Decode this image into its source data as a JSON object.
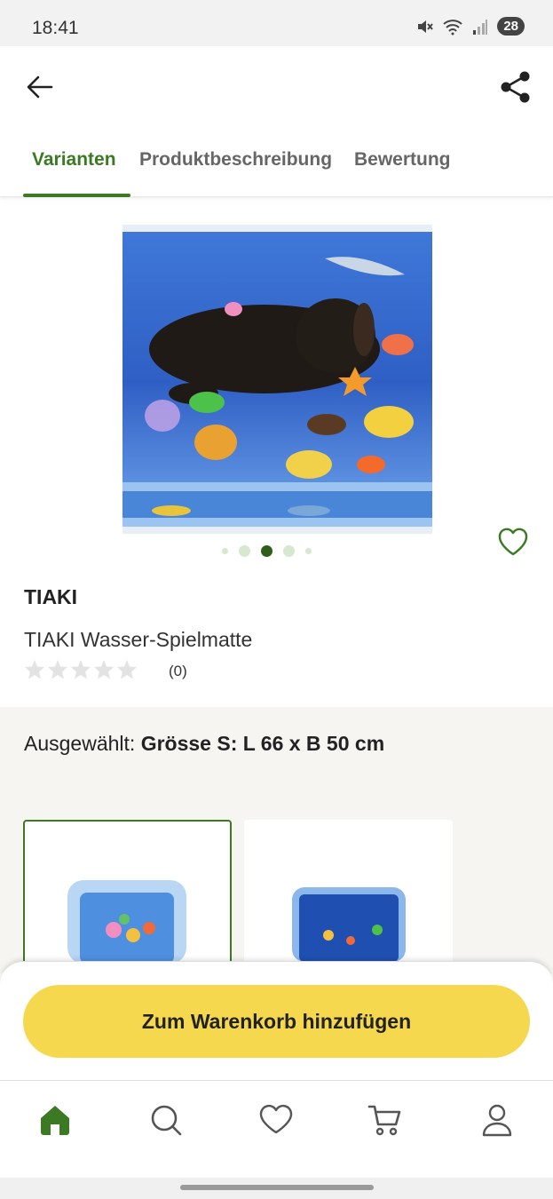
{
  "status": {
    "time": "18:41",
    "battery": "28"
  },
  "tabs": [
    {
      "label": "Varianten",
      "active": true
    },
    {
      "label": "Produktbeschreibung",
      "active": false
    },
    {
      "label": "Bewertung",
      "active": false
    }
  ],
  "product": {
    "brand": "TIAKI",
    "name": "TIAKI Wasser-Spielmatte",
    "rating_count": "(0)",
    "rating": 0,
    "rating_max": 5,
    "image_page": 3,
    "image_pages": 5
  },
  "variants": {
    "selected_prefix": "Ausgewählt:",
    "selected_value": "Grösse S: L 66 x B 50 cm"
  },
  "cta": {
    "label": "Zum Warenkorb hinzufügen"
  },
  "colors": {
    "accent": "#3b7a22",
    "cta": "#f5d84e"
  },
  "icons": {
    "nav": [
      "home-icon",
      "search-icon",
      "heart-icon",
      "cart-icon",
      "profile-icon"
    ]
  }
}
